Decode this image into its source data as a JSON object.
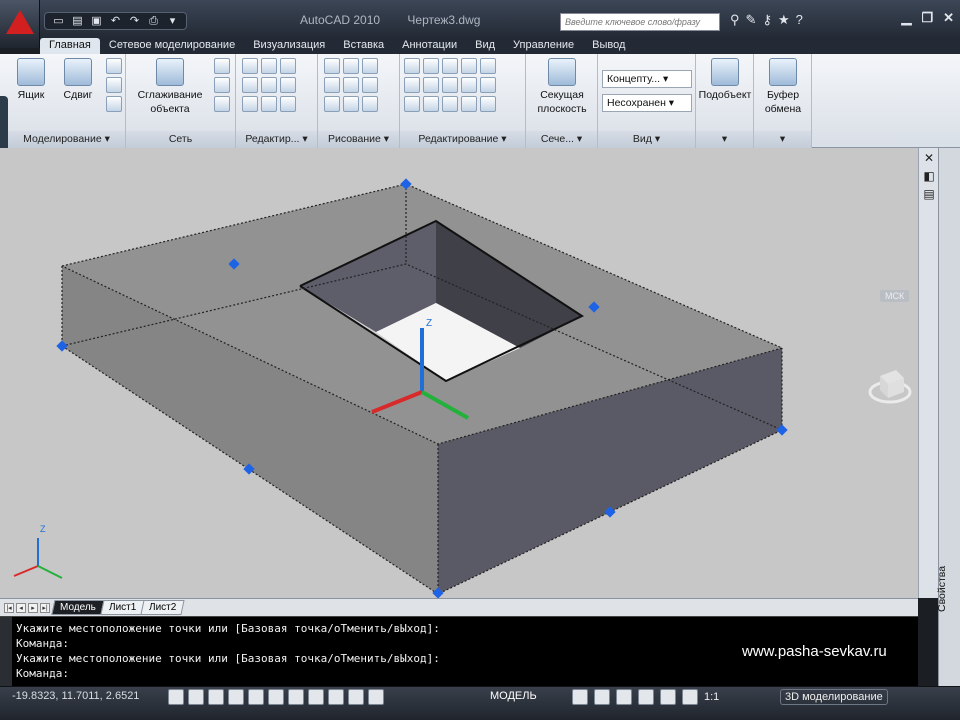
{
  "titlebar": {
    "app_name": "AutoCAD 2010",
    "document": "Чертеж3.dwg",
    "search_placeholder": "Введите ключевое слово/фразу"
  },
  "tabs": [
    "Главная",
    "Сетевое моделирование",
    "Визуализация",
    "Вставка",
    "Аннотации",
    "Вид",
    "Управление",
    "Вывод"
  ],
  "ribbon": {
    "panels": {
      "modeling": "Моделирование ▾",
      "mesh": "Сеть",
      "edit_solid": "Редактир... ▾",
      "draw": "Рисование ▾",
      "modify": "Редактирование ▾",
      "section": "Сече... ▾",
      "view": "Вид ▾"
    },
    "buttons": {
      "box": "Ящик",
      "extrude": "Сдвиг",
      "smooth": "Сглаживание объекта",
      "section_plane": "Секущая плоскость",
      "subobject": "Подобъект",
      "clipboard": "Буфер обмена"
    },
    "dropdowns": {
      "visual_style": "Концепту...",
      "view_state": "Несохранен"
    }
  },
  "viewport": {
    "ucs_label": "МСК",
    "axis_z": "Z",
    "axis_x": "X",
    "axis_y": "Y"
  },
  "layout_tabs": [
    "Модель",
    "Лист1",
    "Лист2"
  ],
  "command": {
    "lines": [
      "Укажите местоположение точки или [Базовая точка/оТменить/вЫход]:",
      "Команда:",
      "Укажите местоположение точки или [Базовая точка/оТменить/вЫход]:",
      "Команда:"
    ]
  },
  "watermark": "www.pasha-sevkav.ru",
  "properties_label": "Свойства",
  "status": {
    "coords": "-19.8323, 11.7011, 2.6521",
    "model": "МОДЕЛЬ",
    "scale": "1:1",
    "workspace": "3D моделирование"
  },
  "colors": {
    "accent_red": "#d21f1f",
    "grip_blue": "#1e63e6",
    "viewport_bg": "#c7c7c7"
  }
}
